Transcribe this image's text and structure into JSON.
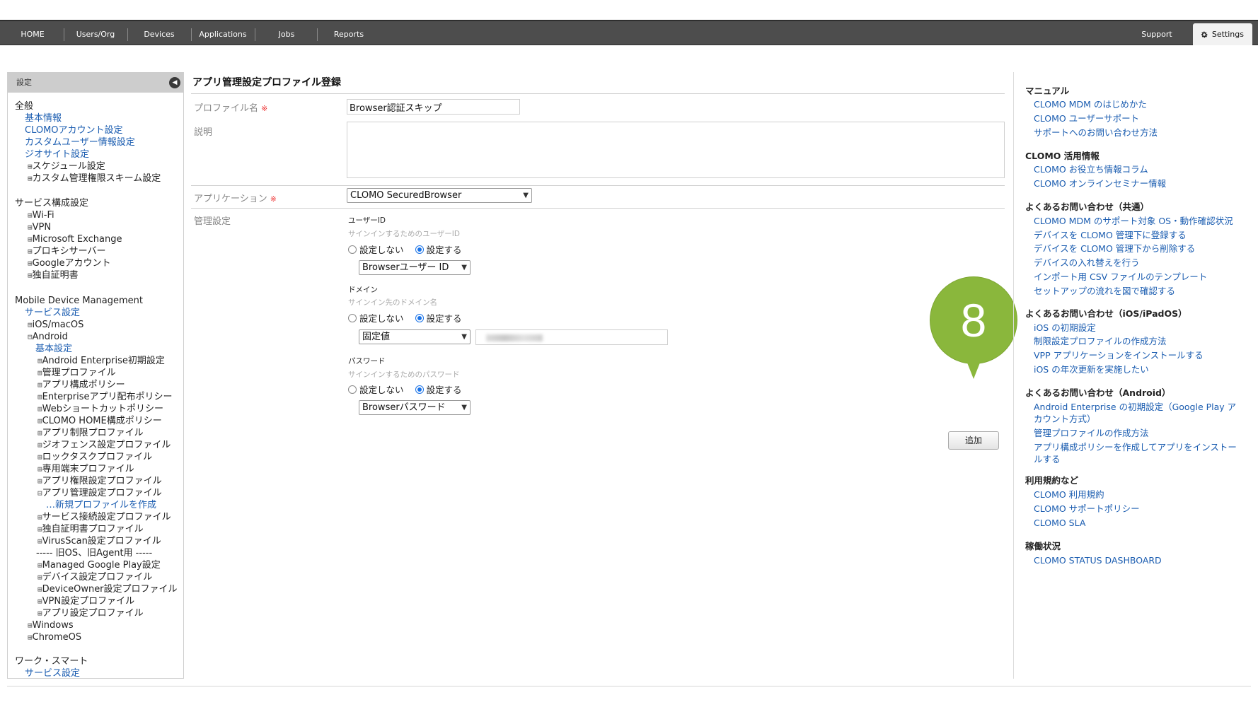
{
  "nav": {
    "items": [
      "HOME",
      "Users/Org",
      "Devices",
      "Applications",
      "Jobs",
      "Reports"
    ],
    "support": "Support",
    "settings": "Settings"
  },
  "sidebar": {
    "title": "設定",
    "collapse_icon": "chevron-left-icon",
    "items": [
      "全般",
      "基本情報",
      "CLOMOアカウント設定",
      "カスタムユーザー情報設定",
      "ジオサイト設定",
      "スケジュール設定",
      "カスタム管理権限スキーム設定",
      "サービス構成設定",
      "Wi-Fi",
      "VPN",
      "Microsoft Exchange",
      "プロキシサーバー",
      "Googleアカウント",
      "独自証明書",
      "Mobile Device Management",
      "サービス設定",
      "iOS/macOS",
      "Android",
      "基本設定",
      "Android Enterprise初期設定",
      "管理プロファイル",
      "アプリ構成ポリシー",
      "Enterpriseアプリ配布ポリシー",
      "Webショートカットポリシー",
      "CLOMO HOME構成ポリシー",
      "アプリ制限プロファイル",
      "ジオフェンス設定プロファイル",
      "ロックタスクプロファイル",
      "専用端末プロファイル",
      "アプリ権限設定プロファイル",
      "アプリ管理設定プロファイル",
      "…新規プロファイルを作成",
      "サービス接続設定プロファイル",
      "独自証明書プロファイル",
      "VirusScan設定プロファイル",
      "----- 旧OS、旧Agent用 -----",
      "Managed Google Play設定",
      "デバイス設定プロファイル",
      "DeviceOwner設定プロファイル",
      "VPN設定プロファイル",
      "アプリ設定プロファイル",
      "Windows",
      "ChromeOS",
      "ワーク・スマート",
      "サービス設定"
    ],
    "plus": "⊞",
    "minus": "⊟"
  },
  "main": {
    "title": "アプリ管理設定プロファイル登録",
    "required_mark": "※",
    "profile_name_label": "プロファイル名",
    "profile_name_value": "Browser認証スキップ",
    "description_label": "説明",
    "description_value": "",
    "application_label": "アプリケーション",
    "application_value": "CLOMO SecuredBrowser",
    "management_label": "管理設定",
    "user_id": {
      "label": "ユーザーID",
      "hint": "サインインするためのユーザーID",
      "opt_off": "設定しない",
      "opt_on": "設定する",
      "select": "Browserユーザー ID"
    },
    "domain": {
      "label": "ドメイン",
      "hint": "サインイン先のドメイン名",
      "opt_off": "設定しない",
      "opt_on": "設定する",
      "select": "固定値",
      "value": ""
    },
    "password": {
      "label": "パスワード",
      "hint": "サインインするためのパスワード",
      "opt_off": "設定しない",
      "opt_on": "設定する",
      "select": "Browserパスワード"
    },
    "add_button": "追加",
    "step_marker": "8"
  },
  "right_panel": {
    "sections": [
      {
        "head": "マニュアル",
        "links": [
          "CLOMO MDM のはじめかた",
          "CLOMO ユーザーサポート",
          "サポートへのお問い合わせ方法"
        ]
      },
      {
        "head": "CLOMO 活用情報",
        "links": [
          "CLOMO お役立ち情報コラム",
          "CLOMO オンラインセミナー情報"
        ]
      },
      {
        "head": "よくあるお問い合わせ（共通）",
        "links": [
          "CLOMO MDM のサポート対象 OS・動作確認状況",
          "デバイスを CLOMO 管理下に登録する",
          "デバイスを CLOMO 管理下から削除する",
          "デバイスの入れ替えを行う",
          "インポート用 CSV ファイルのテンプレート",
          "セットアップの流れを図で確認する"
        ]
      },
      {
        "head": "よくあるお問い合わせ（iOS/iPadOS）",
        "links": [
          "iOS の初期設定",
          "制限設定プロファイルの作成方法",
          "VPP アプリケーションをインストールする",
          "iOS の年次更新を実施したい"
        ]
      },
      {
        "head": "よくあるお問い合わせ（Android）",
        "links": [
          "Android Enterprise の初期設定（Google Play アカウント方式）",
          "管理プロファイルの作成方法",
          "アプリ構成ポリシーを作成してアプリをインストールする"
        ]
      },
      {
        "head": "利用規約など",
        "links": [
          "CLOMO 利用規約",
          "CLOMO サポートポリシー",
          "CLOMO SLA"
        ]
      },
      {
        "head": "稼働状況",
        "links": [
          "CLOMO STATUS DASHBOARD"
        ]
      }
    ]
  }
}
